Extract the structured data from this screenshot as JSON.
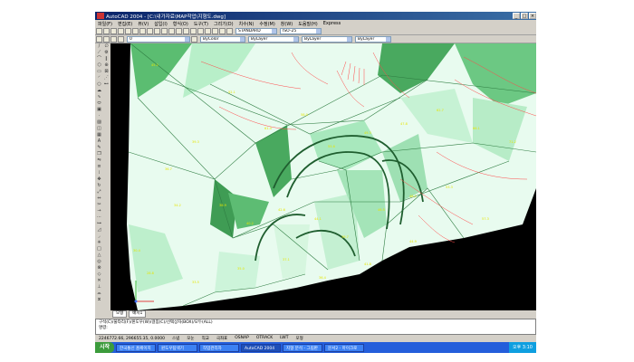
{
  "window": {
    "title": "AutoCAD 2004 - [C:\\내가자료\\MAP작업\\지형도.dwg]"
  },
  "menu": [
    "파일(F)",
    "편집(E)",
    "뷰(V)",
    "삽입(I)",
    "형식(O)",
    "도구(T)",
    "그리기(D)",
    "치수(N)",
    "수정(M)",
    "창(W)",
    "도움말(H)",
    "Express"
  ],
  "toolbar": {
    "layer_select": "0",
    "textstyle_select": "STANDARD",
    "dimstyle_select": "ISO-25",
    "layer_combo": "ByLayer",
    "linetype_combo": "ByLayer",
    "lineweight_combo": "ByLayer",
    "color_combo": "ByColor"
  },
  "tabs": [
    "모형",
    "배치1"
  ],
  "command": {
    "line1": "구석(C)/울타리(F)/윈도우(W)/걸침(C)/선택상자(BOX)/모두(ALL)",
    "line2": "명령:"
  },
  "status": {
    "coords": "2246772.66, 296655.35, 0.0000",
    "modes": [
      "스냅",
      "모눈",
      "직교",
      "극좌표",
      "OSNAP",
      "OTRACK",
      "LWT",
      "모형"
    ]
  },
  "taskbar": {
    "start": "시작",
    "tasks": [
      "한국통신 홈페이지",
      "윈도우탐색기",
      "작업관리자",
      "AutoCAD 2004",
      "지형 분석 - 그림판",
      "문서2 - 마이크로"
    ],
    "clock": "오후 3:10"
  },
  "colors": {
    "canvas": "#000000",
    "surface_light": "#e8fbef",
    "surface_mid": "#a8e8bd",
    "surface_dark": "#49a95f",
    "contour": "#ff4a4a",
    "label": "#e6e600"
  }
}
